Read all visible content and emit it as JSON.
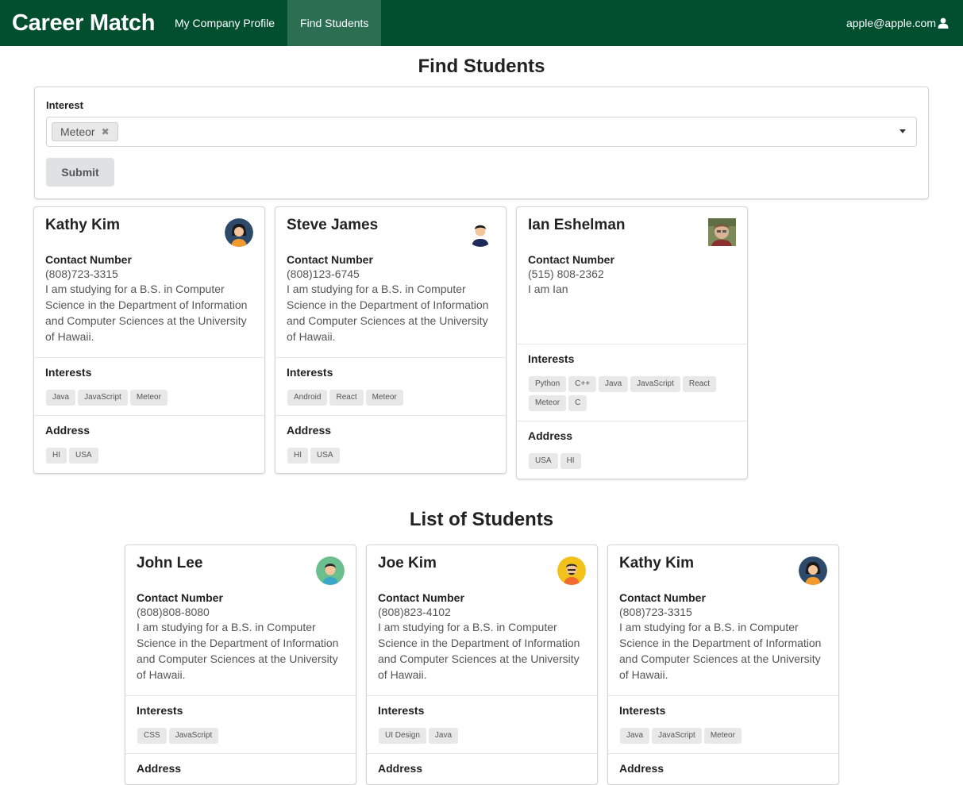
{
  "nav": {
    "brand": "Career Match",
    "items": [
      {
        "label": "My Company Profile",
        "active": false
      },
      {
        "label": "Find Students",
        "active": true
      }
    ],
    "user": "apple@apple.com",
    "bg_color": "#024f2f",
    "active_color": "#2b6e51"
  },
  "find": {
    "title": "Find Students",
    "interest_label": "Interest",
    "selected_interest": "Meteor",
    "submit_label": "Submit"
  },
  "labels": {
    "contact": "Contact Number",
    "interests": "Interests",
    "address": "Address"
  },
  "results": [
    {
      "name": "Kathy Kim",
      "avatar": "female-avatar-icon",
      "phone": "(808)723-3315",
      "bio": "I am studying for a B.S. in Computer Science in the Department of Information and Computer Sciences at the University of Hawaii.",
      "interests": [
        "Java",
        "JavaScript",
        "Meteor"
      ],
      "address": [
        "HI",
        "USA"
      ]
    },
    {
      "name": "Steve James",
      "avatar": "male-avatar-icon",
      "phone": "(808)123-6745",
      "bio": "I am studying for a B.S. in Computer Science in the Department of Information and Computer Sciences at the University of Hawaii.",
      "interests": [
        "Android",
        "React",
        "Meteor"
      ],
      "address": [
        "HI",
        "USA"
      ]
    },
    {
      "name": "Ian Eshelman",
      "avatar": "photo-avatar",
      "phone": "(515) 808-2362",
      "bio": "I am Ian",
      "interests": [
        "Python",
        "C++",
        "Java",
        "JavaScript",
        "React",
        "Meteor",
        "C"
      ],
      "address": [
        "USA",
        "HI"
      ]
    }
  ],
  "list": {
    "title": "List of Students",
    "students": [
      {
        "name": "John Lee",
        "avatar": "male-avatar-icon",
        "phone": "(808)808-8080",
        "bio": "I am studying for a B.S. in Computer Science in the Department of Information and Computer Sciences at the University of Hawaii.",
        "interests": [
          "CSS",
          "JavaScript"
        ]
      },
      {
        "name": "Joe Kim",
        "avatar": "male-avatar-icon",
        "phone": "(808)823-4102",
        "bio": "I am studying for a B.S. in Computer Science in the Department of Information and Computer Sciences at the University of Hawaii.",
        "interests": [
          "UI Design",
          "Java"
        ]
      },
      {
        "name": "Kathy Kim",
        "avatar": "female-avatar-icon",
        "phone": "(808)723-3315",
        "bio": "I am studying for a B.S. in Computer Science in the Department of Information and Computer Sciences at the University of Hawaii.",
        "interests": [
          "Java",
          "JavaScript",
          "Meteor"
        ]
      }
    ]
  }
}
